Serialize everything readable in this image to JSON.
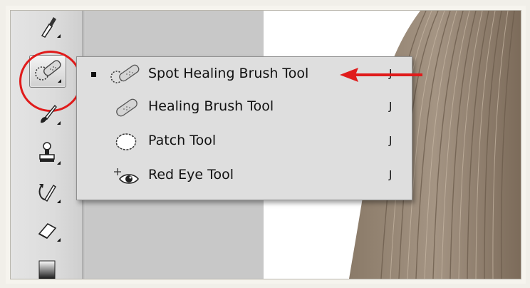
{
  "flyout_menu": {
    "items": [
      {
        "label": "Spot Healing Brush Tool",
        "shortcut": "J",
        "selected": true,
        "icon": "spot-healing-brush-icon"
      },
      {
        "label": "Healing Brush Tool",
        "shortcut": "J",
        "selected": false,
        "icon": "healing-brush-icon"
      },
      {
        "label": "Patch Tool",
        "shortcut": "J",
        "selected": false,
        "icon": "patch-icon"
      },
      {
        "label": "Red Eye Tool",
        "shortcut": "J",
        "selected": false,
        "icon": "red-eye-icon"
      }
    ]
  },
  "toolbar": {
    "tools": [
      {
        "icon": "eyedropper-icon"
      },
      {
        "icon": "spot-healing-brush-icon",
        "active": true
      },
      {
        "icon": "brush-icon"
      },
      {
        "icon": "clone-stamp-icon"
      },
      {
        "icon": "history-brush-icon"
      },
      {
        "icon": "eraser-icon"
      },
      {
        "icon": "gradient-icon"
      }
    ]
  },
  "annotation": {
    "color": "#e01b1b",
    "marks": [
      "red-circle",
      "red-arrow"
    ]
  }
}
